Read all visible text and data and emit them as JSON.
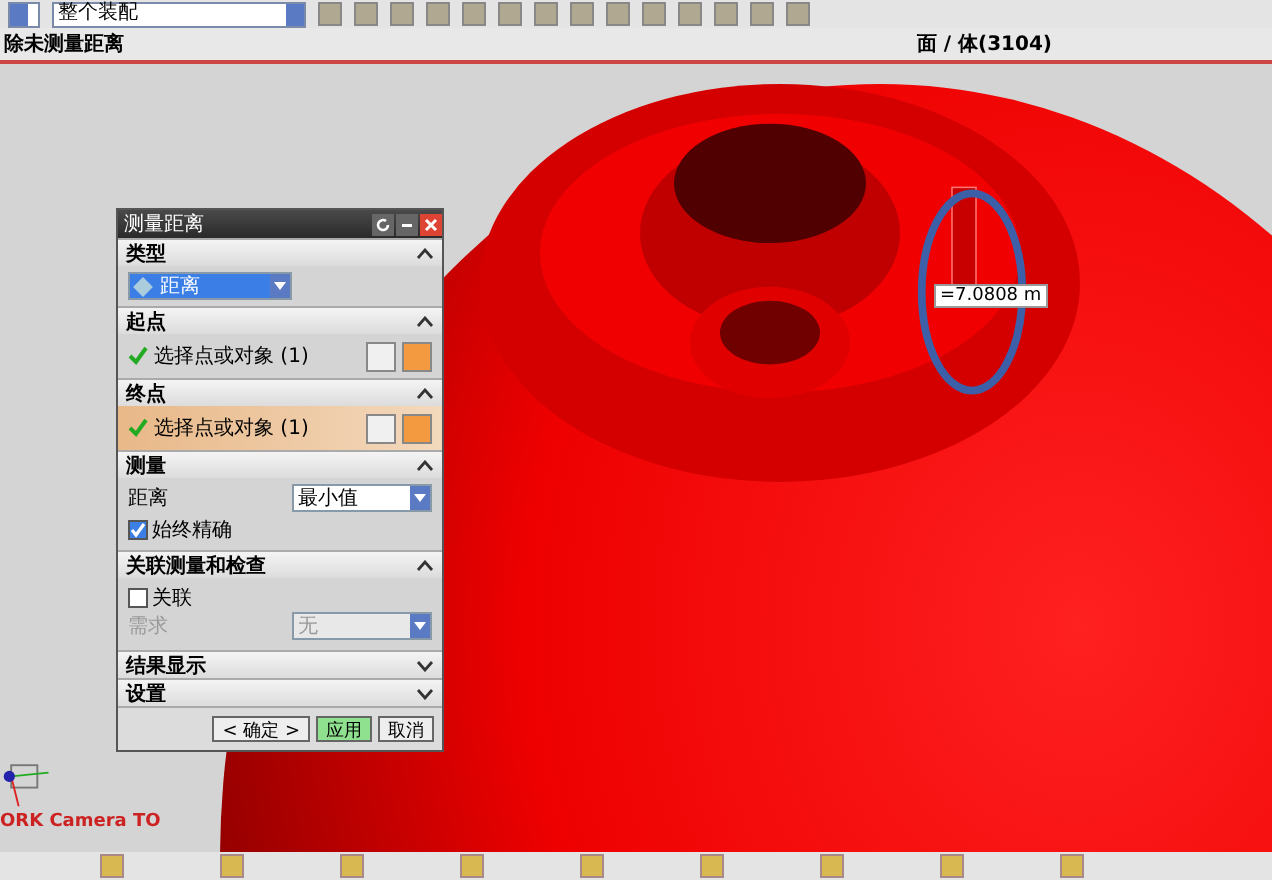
{
  "toolbar": {
    "assembly_dropdown": "整个装配"
  },
  "status_bar": {
    "prompt": "除未测量距离",
    "selection": "面 / 体(3104)"
  },
  "viewport": {
    "measurement_label": "=7.0808 m",
    "view_label": "ORK Camera TO"
  },
  "dialog": {
    "title": "测量距离",
    "sections": [
      {
        "kind": "type",
        "title": "类型",
        "expanded": true,
        "value": "距离"
      },
      {
        "kind": "point",
        "title": "起点",
        "expanded": true,
        "label": "选择点或对象 (1)",
        "selected": false
      },
      {
        "kind": "point",
        "title": "终点",
        "expanded": true,
        "label": "选择点或对象 (1)",
        "selected": true
      },
      {
        "kind": "measure",
        "title": "测量",
        "expanded": true,
        "field_label": "距离",
        "value": "最小值",
        "checkbox": {
          "label": "始终精确",
          "checked": true
        }
      },
      {
        "kind": "assoc",
        "title": "关联测量和检查",
        "expanded": true,
        "checkbox": {
          "label": "关联",
          "checked": false
        },
        "field_label": "需求",
        "value": "无",
        "disabled": true
      },
      {
        "title": "结果显示",
        "expanded": false
      },
      {
        "title": "设置",
        "expanded": false
      }
    ],
    "buttons": [
      {
        "label": "< 确定 >",
        "primary": false
      },
      {
        "label": "应用",
        "primary": true
      },
      {
        "label": "取消",
        "primary": false
      }
    ]
  }
}
